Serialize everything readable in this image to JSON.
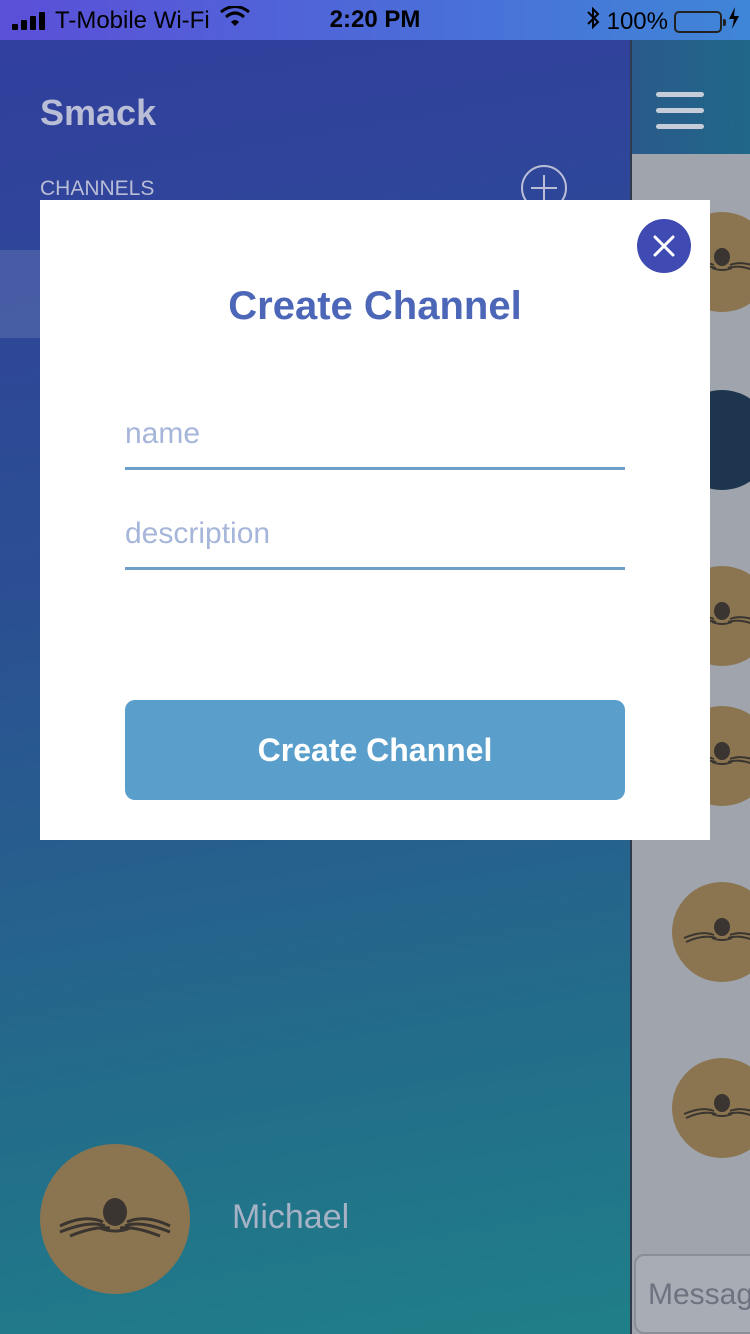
{
  "status_bar": {
    "carrier": "T-Mobile Wi-Fi",
    "time": "2:20 PM",
    "battery": "100%"
  },
  "side_menu": {
    "app_title": "Smack",
    "channels_label": "CHANNELS",
    "user_name": "Michael"
  },
  "chat": {
    "message_placeholder": "Message"
  },
  "modal": {
    "title": "Create Channel",
    "name_placeholder": "name",
    "description_placeholder": "description",
    "create_button_label": "Create Channel"
  },
  "colors": {
    "accent": "#4c66b8",
    "button": "#5a9fcb",
    "close_button": "#3f4bb3",
    "avatar": "#8b7550"
  },
  "icons": {
    "close": "close-icon",
    "add_channel": "plus-circle-icon",
    "menu": "hamburger-menu-icon",
    "avatar": "octopus-icon"
  }
}
